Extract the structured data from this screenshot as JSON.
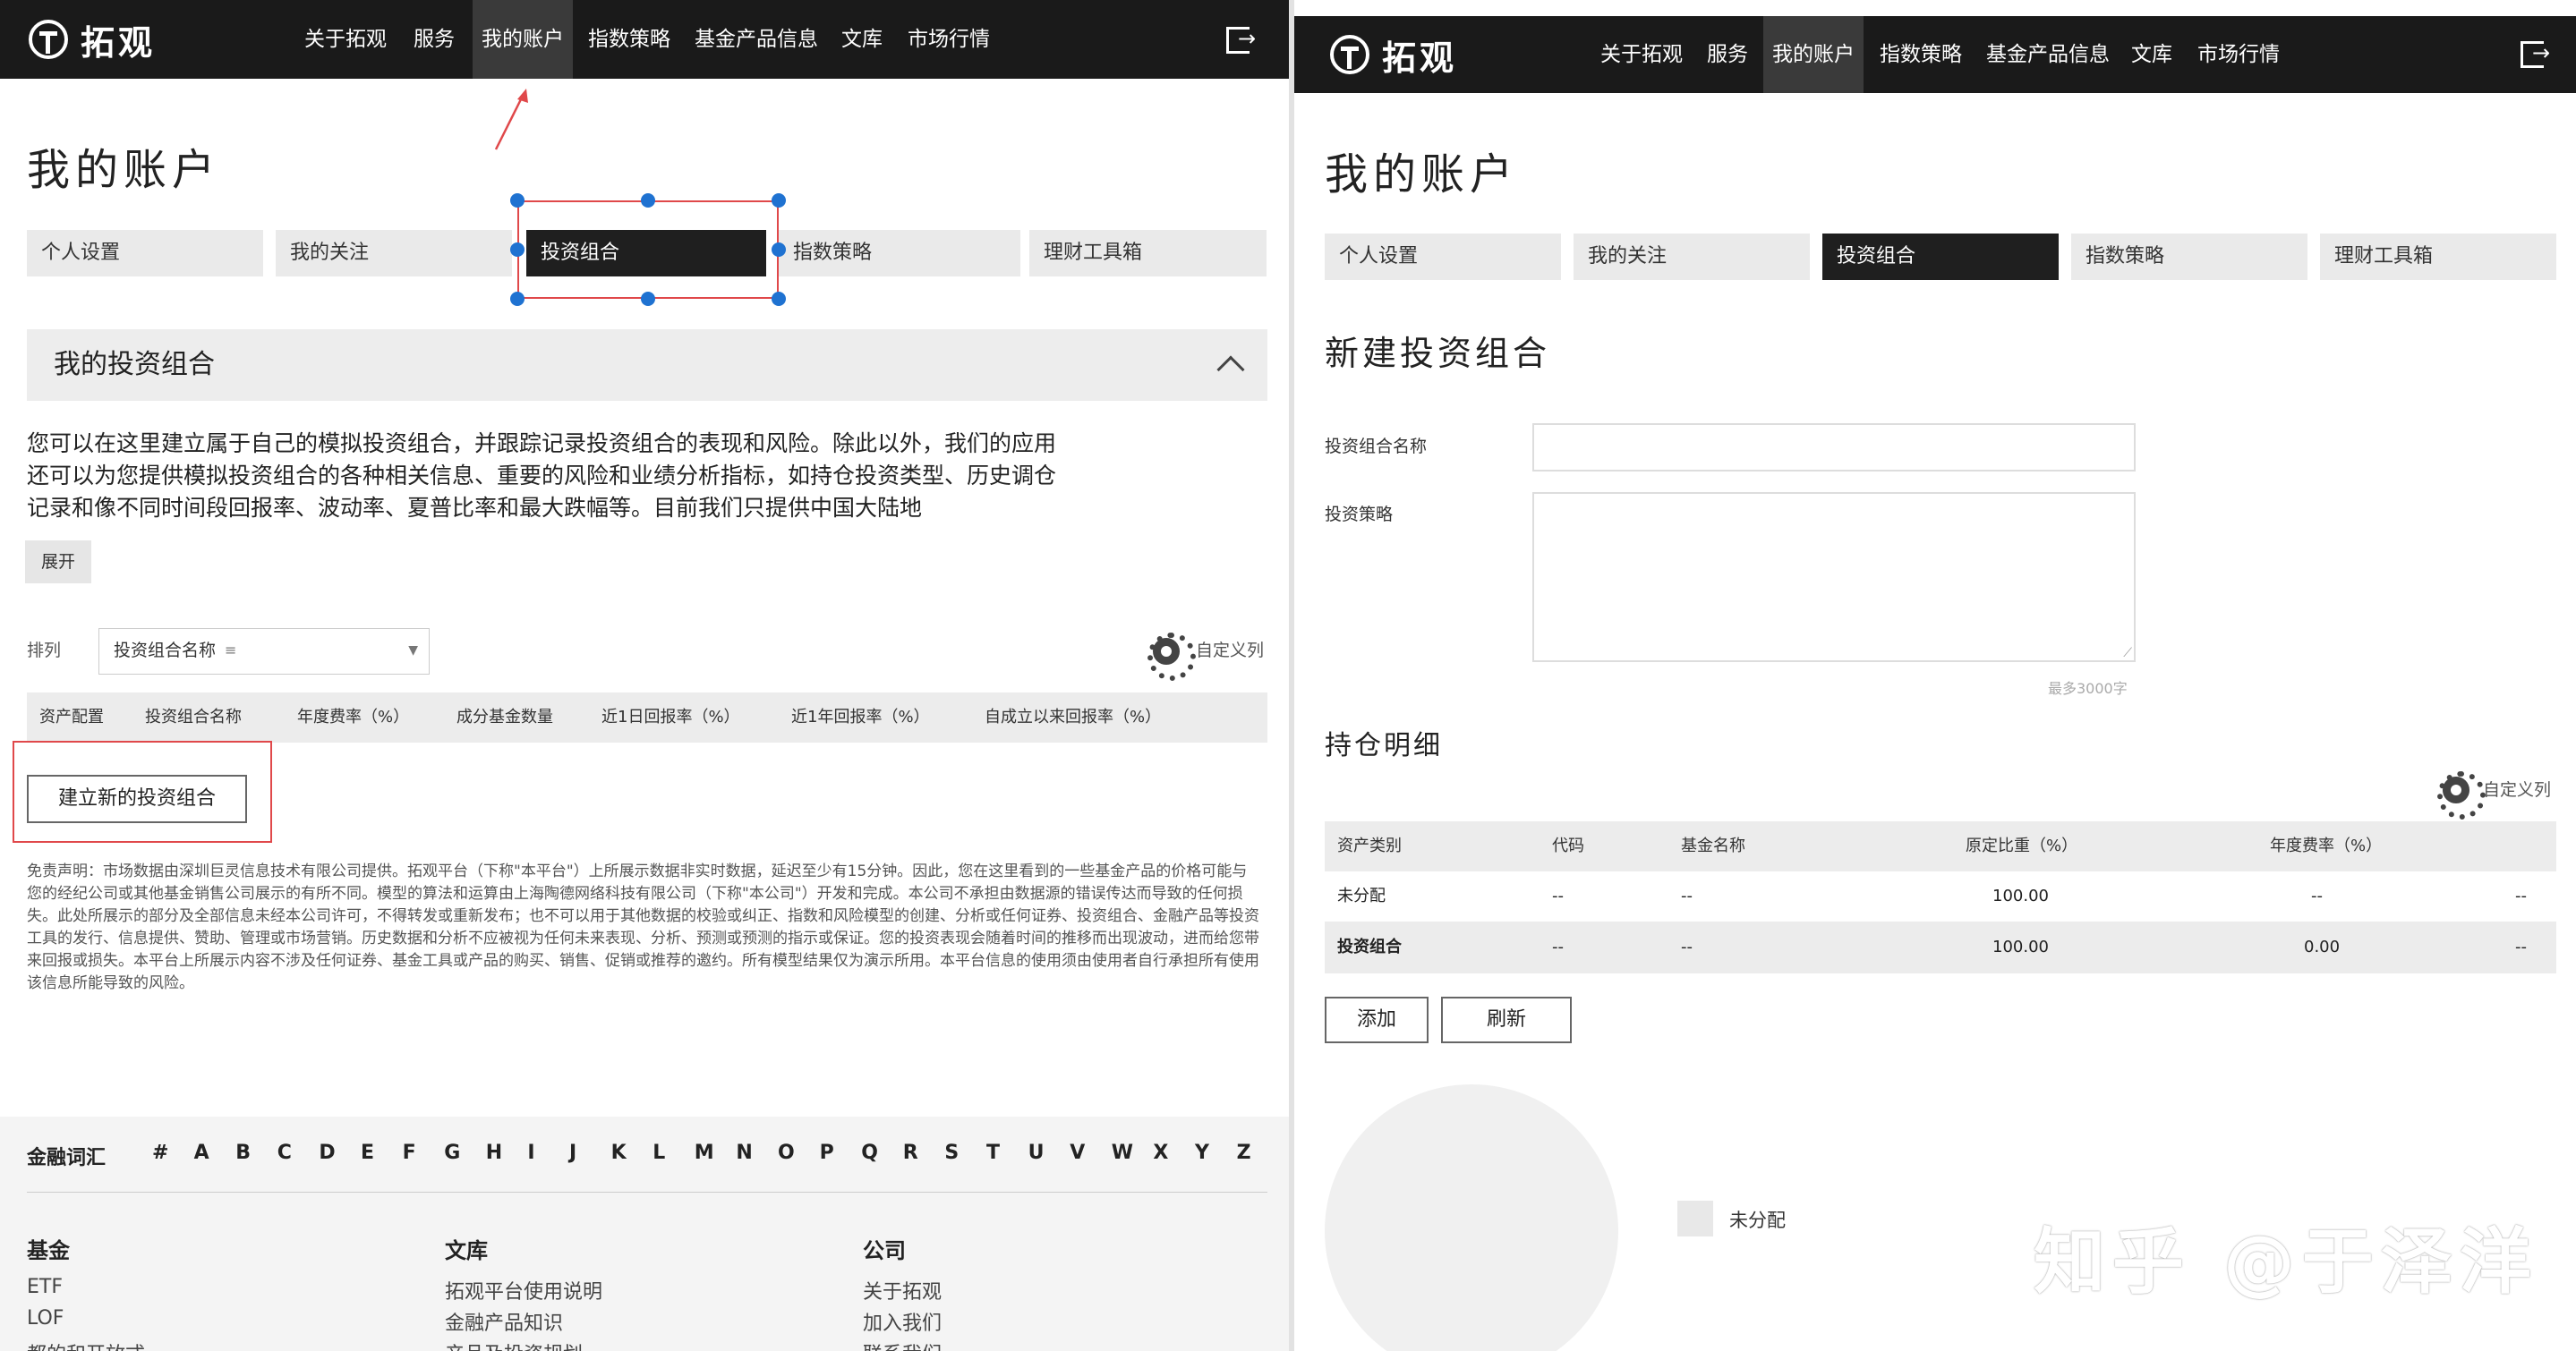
{
  "left": {
    "nav": {
      "brand": "拓观",
      "items": [
        "关于拓观",
        "服务",
        "我的账户",
        "指数策略",
        "基金产品信息",
        "文库",
        "市场行情"
      ],
      "active_index": 2
    },
    "page_title": "我的账户",
    "tabs": [
      "个人设置",
      "我的关注",
      "投资组合",
      "指数策略",
      "理财工具箱"
    ],
    "active_tab": 2,
    "section_title": "我的投资组合",
    "intro_text": "您可以在这里建立属于自己的模拟投资组合，并跟踪记录投资组合的表现和风险。除此以外，我们的应用还可以为您提供模拟投资组合的各种相关信息、重要的风险和业绩分析指标，如持仓投资类型、历史调仓记录和像不同时间段回报率、波动率、夏普比率和最大跌幅等。目前我们只提供中国大陆地",
    "expand_label": "展开",
    "sort": {
      "label": "排列",
      "selected": "投资组合名称"
    },
    "custom_columns_label": "自定义列",
    "table_headers": [
      "资产配置",
      "投资组合名称",
      "年度费率（%）",
      "成分基金数量",
      "近1日回报率（%）",
      "近1年回报率（%）",
      "自成立以来回报率（%）"
    ],
    "new_portfolio_button": "建立新的投资组合",
    "disclaimer": "免责声明：市场数据由深圳巨灵信息技术有限公司提供。拓观平台（下称\"本平台\"）上所展示数据非实时数据，延迟至少有15分钟。因此，您在这里看到的一些基金产品的价格可能与您的经纪公司或其他基金销售公司展示的有所不同。模型的算法和运算由上海陶德网络科技有限公司（下称\"本公司\"）开发和完成。本公司不承担由数据源的错误传达而导致的任何损失。此处所展示的部分及全部信息未经本公司许可，不得转发或重新发布；也不可以用于其他数据的校验或纠正、指数和风险模型的创建、分析或任何证券、投资组合、金融产品等投资工具的发行、信息提供、赞助、管理或市场营销。历史数据和分析不应被视为任何未来表现、分析、预测或预测的指示或保证。您的投资表现会随着时间的推移而出现波动，进而给您带来回报或损失。本平台上所展示内容不涉及任何证券、基金工具或产品的购买、销售、促销或推荐的邀约。所有模型结果仅为演示所用。本平台信息的使用须由使用者自行承担所有使用该信息所能导致的风险。",
    "footer": {
      "glossary_label": "金融词汇",
      "alphabet": [
        "#",
        "A",
        "B",
        "C",
        "D",
        "E",
        "F",
        "G",
        "H",
        "I",
        "J",
        "K",
        "L",
        "M",
        "N",
        "O",
        "P",
        "Q",
        "R",
        "S",
        "T",
        "U",
        "V",
        "W",
        "X",
        "Y",
        "Z"
      ],
      "columns": [
        {
          "title": "基金",
          "links": [
            "ETF",
            "LOF",
            "都的和开放式"
          ]
        },
        {
          "title": "文库",
          "links": [
            "拓观平台使用说明",
            "金融产品知识",
            "产品及投资规划"
          ]
        },
        {
          "title": "公司",
          "links": [
            "关于拓观",
            "加入我们",
            "联系我们"
          ]
        }
      ]
    }
  },
  "right": {
    "nav": {
      "brand": "拓观",
      "items": [
        "关于拓观",
        "服务",
        "我的账户",
        "指数策略",
        "基金产品信息",
        "文库",
        "市场行情"
      ],
      "active_index": 2
    },
    "page_title": "我的账户",
    "tabs": [
      "个人设置",
      "我的关注",
      "投资组合",
      "指数策略",
      "理财工具箱"
    ],
    "active_tab": 2,
    "form_title": "新建投资组合",
    "name_label": "投资组合名称",
    "strategy_label": "投资策略",
    "char_limit": "最多3000字",
    "holdings_title": "持仓明细",
    "custom_columns_label": "自定义列",
    "table_headers": [
      "资产类别",
      "代码",
      "基金名称",
      "原定比重（%）",
      "年度费率（%）"
    ],
    "rows": [
      {
        "cells": [
          "未分配",
          "--",
          "--",
          "100.00",
          "--",
          "--"
        ],
        "bold": false
      },
      {
        "cells": [
          "投资组合",
          "--",
          "--",
          "100.00",
          "0.00",
          "--"
        ],
        "bold": true
      }
    ],
    "add_button": "添加",
    "refresh_button": "刷新",
    "legend_label": "未分配",
    "watermark": "知乎 @于泽洋"
  },
  "colors": {
    "nav_bg": "#1a1a1a",
    "annotation_red": "#e0484a",
    "handle_blue": "#1f72d1",
    "tab_gray": "#eaeaea"
  }
}
